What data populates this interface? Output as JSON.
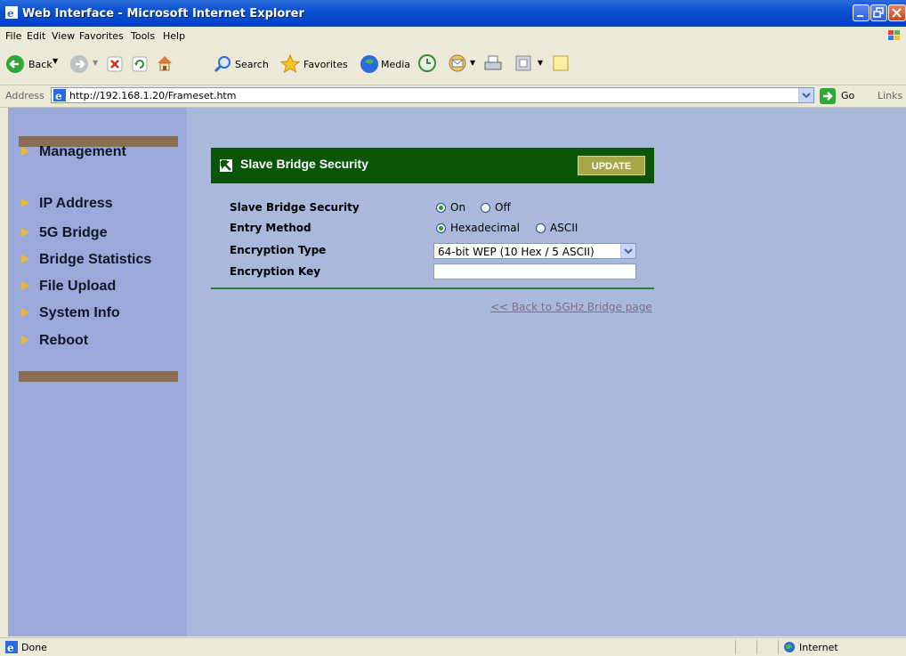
{
  "window": {
    "title": "Web Interface - Microsoft Internet Explorer"
  },
  "menu": [
    "File",
    "Edit",
    "View",
    "Favorites",
    "Tools",
    "Help"
  ],
  "toolbar": {
    "back_label": "Back",
    "search_label": "Search",
    "favorites_label": "Favorites",
    "media_label": "Media"
  },
  "address": {
    "label": "Address",
    "url": "http://192.168.1.20/Frameset.htm",
    "go_label": "Go",
    "links_label": "Links"
  },
  "sidebar": {
    "items": [
      {
        "label": "Management"
      },
      {
        "label": "IP Address"
      },
      {
        "label": "5G Bridge"
      },
      {
        "label": "Bridge Statistics"
      },
      {
        "label": "File Upload"
      },
      {
        "label": "System Info"
      },
      {
        "label": "Reboot"
      }
    ]
  },
  "panel": {
    "title": "Slave Bridge Security",
    "update_label": "UPDATE",
    "fields": {
      "security": {
        "label": "Slave Bridge Security",
        "options": [
          "On",
          "Off"
        ],
        "selected": "On"
      },
      "entry": {
        "label": "Entry Method",
        "options": [
          "Hexadecimal",
          "ASCII"
        ],
        "selected": "Hexadecimal"
      },
      "encryption": {
        "label": "Encryption Type",
        "value": "64-bit WEP (10 Hex / 5 ASCII)"
      },
      "key": {
        "label": "Encryption Key",
        "value": ""
      }
    },
    "back_link": "<< Back to 5GHz Bridge page"
  },
  "status": {
    "text": "Done",
    "zone": "Internet"
  },
  "colors": {
    "header_green": "#0B5508",
    "sidebar_bar": "#8B6E50",
    "content_bg": "#AAB8DC",
    "sidebar_bg": "#9AA9DA",
    "update_btn": "#A7A648"
  }
}
